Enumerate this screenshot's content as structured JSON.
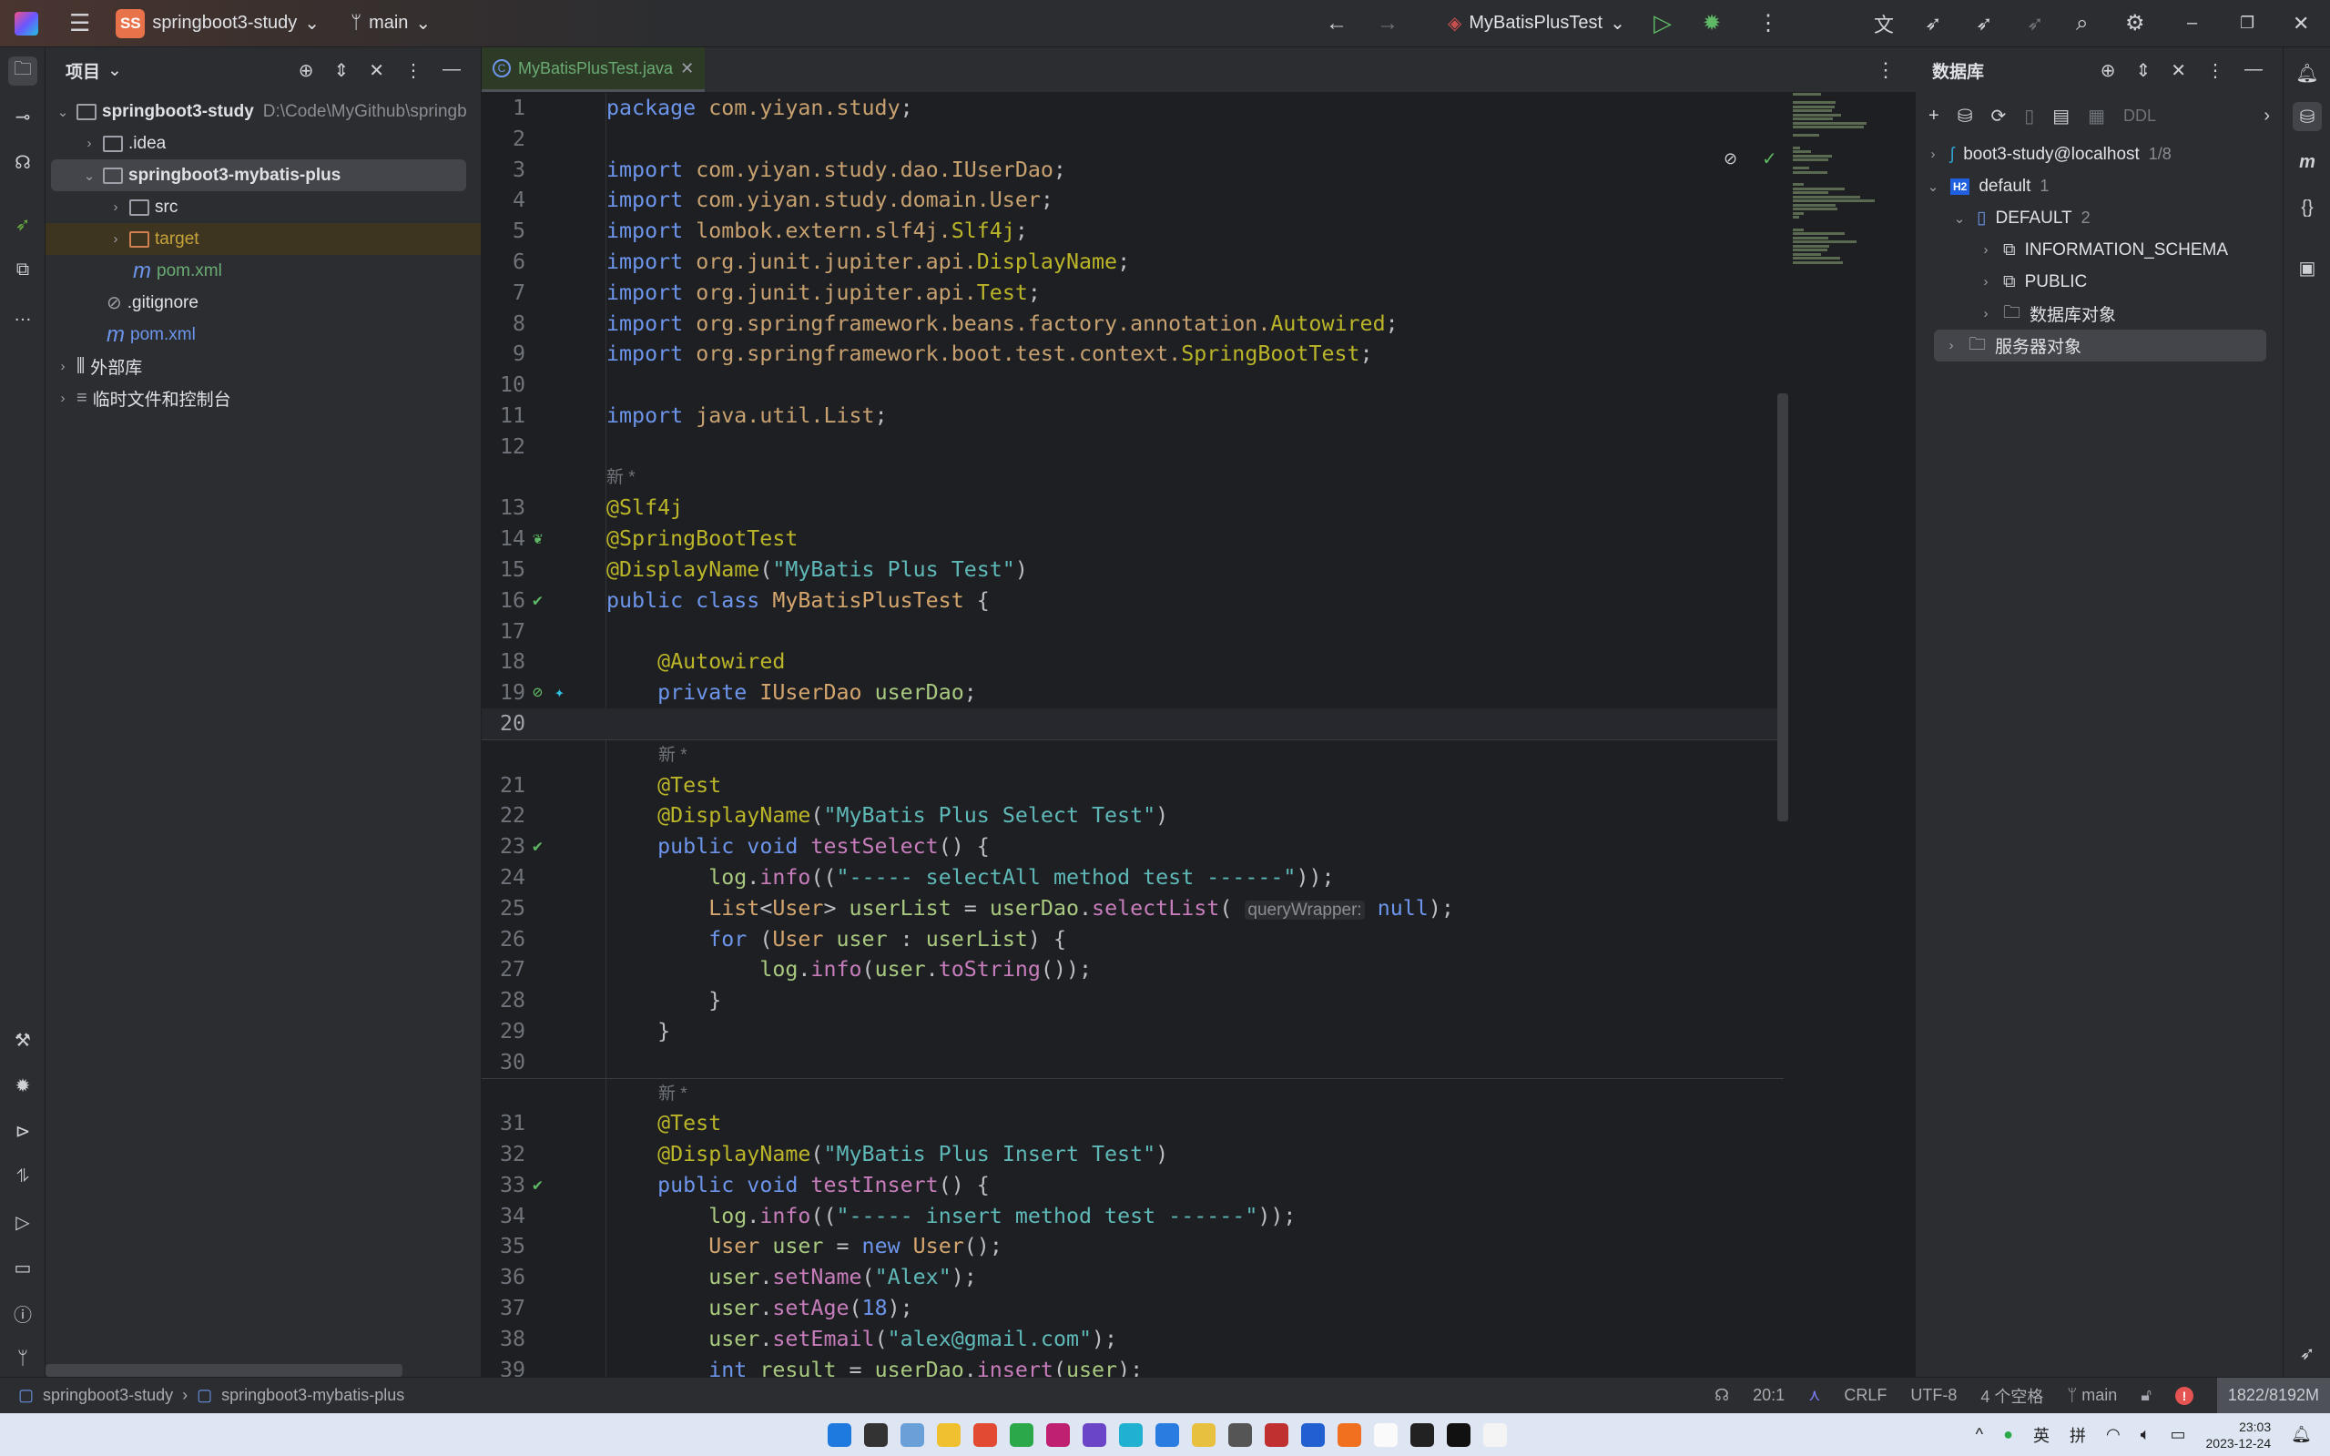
{
  "titlebar": {
    "project_badge": "SS",
    "project": "springboot3-study",
    "branch": "main",
    "run_config": "MyBatisPlusTest"
  },
  "project_panel": {
    "title": "项目",
    "items": [
      {
        "label": "springboot3-study",
        "path": "D:\\Code\\MyGithub\\springb",
        "level": 0,
        "open": true,
        "bold": true,
        "type": "module"
      },
      {
        "label": ".idea",
        "level": 1,
        "open": false,
        "type": "folder"
      },
      {
        "label": "springboot3-mybatis-plus",
        "level": 1,
        "open": true,
        "bold": true,
        "type": "module",
        "selected": true
      },
      {
        "label": "src",
        "level": 2,
        "open": false,
        "type": "folder"
      },
      {
        "label": "target",
        "level": 2,
        "open": false,
        "type": "excluded-folder"
      },
      {
        "label": "pom.xml",
        "level": 2,
        "type": "maven",
        "color": "#6aab73"
      },
      {
        "label": ".gitignore",
        "level": 1,
        "type": "ignore"
      },
      {
        "label": "pom.xml",
        "level": 1,
        "type": "maven",
        "color": "#6c95eb"
      },
      {
        "label": "外部库",
        "level": 0,
        "open": false,
        "type": "library"
      },
      {
        "label": "临时文件和控制台",
        "level": 0,
        "open": false,
        "type": "scratch"
      }
    ]
  },
  "editor": {
    "tab": "MyBatisPlusTest.java",
    "inlay_new": "新 *",
    "lines": [
      {
        "n": "1",
        "t": [
          [
            "kw",
            "package "
          ],
          [
            "pk",
            "com.yiyan.study"
          ],
          [
            "pl",
            ";"
          ]
        ]
      },
      {
        "n": "2",
        "t": []
      },
      {
        "n": "3",
        "t": [
          [
            "kw",
            "import "
          ],
          [
            "pk",
            "com.yiyan.study.dao.IUserDao"
          ],
          [
            "pl",
            ";"
          ]
        ]
      },
      {
        "n": "4",
        "t": [
          [
            "kw",
            "import "
          ],
          [
            "pk",
            "com.yiyan.study.domain.User"
          ],
          [
            "pl",
            ";"
          ]
        ]
      },
      {
        "n": "5",
        "t": [
          [
            "kw",
            "import "
          ],
          [
            "pk",
            "lombok.extern.slf4j."
          ],
          [
            "an",
            "Slf4j"
          ],
          [
            "pl",
            ";"
          ]
        ]
      },
      {
        "n": "6",
        "t": [
          [
            "kw",
            "import "
          ],
          [
            "pk",
            "org.junit.jupiter.api."
          ],
          [
            "an",
            "DisplayName"
          ],
          [
            "pl",
            ";"
          ]
        ]
      },
      {
        "n": "7",
        "t": [
          [
            "kw",
            "import "
          ],
          [
            "pk",
            "org.junit.jupiter.api."
          ],
          [
            "an",
            "Test"
          ],
          [
            "pl",
            ";"
          ]
        ]
      },
      {
        "n": "8",
        "t": [
          [
            "kw",
            "import "
          ],
          [
            "pk",
            "org.springframework.beans.factory.annotation."
          ],
          [
            "an",
            "Autowired"
          ],
          [
            "pl",
            ";"
          ]
        ]
      },
      {
        "n": "9",
        "t": [
          [
            "kw",
            "import "
          ],
          [
            "pk",
            "org.springframework.boot.test.context."
          ],
          [
            "an",
            "SpringBootTest"
          ],
          [
            "pl",
            ";"
          ]
        ]
      },
      {
        "n": "10",
        "t": []
      },
      {
        "n": "11",
        "t": [
          [
            "kw",
            "import "
          ],
          [
            "pk",
            "java.util.List"
          ],
          [
            "pl",
            ";"
          ]
        ]
      },
      {
        "n": "12",
        "t": []
      },
      {
        "inlay": true,
        "indent": 0
      },
      {
        "n": "13",
        "t": [
          [
            "an",
            "@Slf4j"
          ]
        ]
      },
      {
        "n": "14",
        "g": "spring-bean-icon",
        "t": [
          [
            "an",
            "@SpringBootTest"
          ]
        ]
      },
      {
        "n": "15",
        "t": [
          [
            "an",
            "@DisplayName"
          ],
          [
            "pl",
            "("
          ],
          [
            "st",
            "\"MyBatis Plus Test\""
          ],
          [
            "pl",
            ")"
          ]
        ]
      },
      {
        "n": "16",
        "g": "run-test-icon",
        "t": [
          [
            "kw",
            "public class "
          ],
          [
            "ty",
            "MyBatisPlusTest"
          ],
          [
            "pl",
            " {"
          ]
        ]
      },
      {
        "n": "17",
        "t": []
      },
      {
        "n": "18",
        "t": [
          [
            "pl",
            "    "
          ],
          [
            "an",
            "@Autowired"
          ]
        ]
      },
      {
        "n": "19",
        "g": "autowired-bean-icon",
        "g2": "mybatis-bird-icon",
        "t": [
          [
            "pl",
            "    "
          ],
          [
            "kw",
            "private "
          ],
          [
            "ty",
            "IUserDao "
          ],
          [
            "vr",
            "userDao"
          ],
          [
            "pl",
            ";"
          ]
        ]
      },
      {
        "n": "20",
        "cur": true,
        "t": []
      },
      {
        "inlay": true,
        "indent": 1,
        "sep": true
      },
      {
        "n": "21",
        "t": [
          [
            "pl",
            "    "
          ],
          [
            "an",
            "@Test"
          ]
        ]
      },
      {
        "n": "22",
        "t": [
          [
            "pl",
            "    "
          ],
          [
            "an",
            "@DisplayName"
          ],
          [
            "pl",
            "("
          ],
          [
            "st",
            "\"MyBatis Plus Select Test\""
          ],
          [
            "pl",
            ")"
          ]
        ]
      },
      {
        "n": "23",
        "g": "run-test-icon",
        "t": [
          [
            "pl",
            "    "
          ],
          [
            "kw",
            "public void "
          ],
          [
            "me",
            "testSelect"
          ],
          [
            "pl",
            "() {"
          ]
        ]
      },
      {
        "n": "24",
        "t": [
          [
            "pl",
            "        "
          ],
          [
            "vr",
            "log"
          ],
          [
            "pl",
            "."
          ],
          [
            "me",
            "info"
          ],
          [
            "pl",
            "(("
          ],
          [
            "st",
            "\"----- selectAll method test ------\""
          ],
          [
            "pl",
            "));"
          ]
        ]
      },
      {
        "n": "25",
        "t": [
          [
            "pl",
            "        "
          ],
          [
            "ty",
            "List"
          ],
          [
            "pl",
            "<"
          ],
          [
            "ty",
            "User"
          ],
          [
            "pl",
            "> "
          ],
          [
            "vr",
            "userList"
          ],
          [
            "pl",
            " = "
          ],
          [
            "vr",
            "userDao"
          ],
          [
            "pl",
            "."
          ],
          [
            "me",
            "selectList"
          ],
          [
            "pl",
            "( "
          ],
          [
            "hint",
            "queryWrapper:"
          ],
          [
            "kw",
            " null"
          ],
          [
            "pl",
            ");"
          ]
        ]
      },
      {
        "n": "26",
        "t": [
          [
            "pl",
            "        "
          ],
          [
            "kw",
            "for "
          ],
          [
            "pl",
            "("
          ],
          [
            "ty",
            "User "
          ],
          [
            "vr",
            "user"
          ],
          [
            "pl",
            " : "
          ],
          [
            "vr",
            "userList"
          ],
          [
            "pl",
            ") {"
          ]
        ]
      },
      {
        "n": "27",
        "t": [
          [
            "pl",
            "            "
          ],
          [
            "vr",
            "log"
          ],
          [
            "pl",
            "."
          ],
          [
            "me",
            "info"
          ],
          [
            "pl",
            "("
          ],
          [
            "vr",
            "user"
          ],
          [
            "pl",
            "."
          ],
          [
            "me",
            "toString"
          ],
          [
            "pl",
            "());"
          ]
        ]
      },
      {
        "n": "28",
        "t": [
          [
            "pl",
            "        }"
          ]
        ]
      },
      {
        "n": "29",
        "t": [
          [
            "pl",
            "    }"
          ]
        ]
      },
      {
        "n": "30",
        "t": []
      },
      {
        "inlay": true,
        "indent": 1,
        "sep": true
      },
      {
        "n": "31",
        "t": [
          [
            "pl",
            "    "
          ],
          [
            "an",
            "@Test"
          ]
        ]
      },
      {
        "n": "32",
        "t": [
          [
            "pl",
            "    "
          ],
          [
            "an",
            "@DisplayName"
          ],
          [
            "pl",
            "("
          ],
          [
            "st",
            "\"MyBatis Plus Insert Test\""
          ],
          [
            "pl",
            ")"
          ]
        ]
      },
      {
        "n": "33",
        "g": "run-test-icon",
        "t": [
          [
            "pl",
            "    "
          ],
          [
            "kw",
            "public void "
          ],
          [
            "me",
            "testInsert"
          ],
          [
            "pl",
            "() {"
          ]
        ]
      },
      {
        "n": "34",
        "t": [
          [
            "pl",
            "        "
          ],
          [
            "vr",
            "log"
          ],
          [
            "pl",
            "."
          ],
          [
            "me",
            "info"
          ],
          [
            "pl",
            "(("
          ],
          [
            "st",
            "\"----- insert method test ------\""
          ],
          [
            "pl",
            "));"
          ]
        ]
      },
      {
        "n": "35",
        "t": [
          [
            "pl",
            "        "
          ],
          [
            "ty",
            "User "
          ],
          [
            "vr",
            "user"
          ],
          [
            "pl",
            " = "
          ],
          [
            "kw",
            "new "
          ],
          [
            "ty",
            "User"
          ],
          [
            "pl",
            "();"
          ]
        ]
      },
      {
        "n": "36",
        "t": [
          [
            "pl",
            "        "
          ],
          [
            "vr",
            "user"
          ],
          [
            "pl",
            "."
          ],
          [
            "me",
            "setName"
          ],
          [
            "pl",
            "("
          ],
          [
            "st",
            "\"Alex\""
          ],
          [
            "pl",
            ");"
          ]
        ]
      },
      {
        "n": "37",
        "t": [
          [
            "pl",
            "        "
          ],
          [
            "vr",
            "user"
          ],
          [
            "pl",
            "."
          ],
          [
            "me",
            "setAge"
          ],
          [
            "pl",
            "("
          ],
          [
            "kw",
            "18"
          ],
          [
            "pl",
            ");"
          ]
        ]
      },
      {
        "n": "38",
        "t": [
          [
            "pl",
            "        "
          ],
          [
            "vr",
            "user"
          ],
          [
            "pl",
            "."
          ],
          [
            "me",
            "setEmail"
          ],
          [
            "pl",
            "("
          ],
          [
            "st",
            "\"alex@gmail.com\""
          ],
          [
            "pl",
            ");"
          ]
        ]
      },
      {
        "n": "39",
        "t": [
          [
            "pl",
            "        "
          ],
          [
            "kw",
            "int "
          ],
          [
            "vr",
            "result"
          ],
          [
            "pl",
            " = "
          ],
          [
            "vr",
            "userDao"
          ],
          [
            "pl",
            "."
          ],
          [
            "me",
            "insert"
          ],
          [
            "pl",
            "("
          ],
          [
            "vr",
            "user"
          ],
          [
            "pl",
            ");"
          ]
        ]
      }
    ]
  },
  "database_panel": {
    "title": "数据库",
    "ddl_label": "DDL",
    "items": [
      {
        "label": "boot3-study@localhost",
        "badge": "1/8",
        "level": 0,
        "open": false,
        "type": "mysql"
      },
      {
        "label": "default",
        "badge": "1",
        "level": 0,
        "open": true,
        "type": "h2"
      },
      {
        "label": "DEFAULT",
        "badge": "2",
        "level": 1,
        "open": true,
        "type": "database"
      },
      {
        "label": "INFORMATION_SCHEMA",
        "level": 2,
        "open": false,
        "type": "schema"
      },
      {
        "label": "PUBLIC",
        "level": 2,
        "open": false,
        "type": "schema"
      },
      {
        "label": "数据库对象",
        "level": 2,
        "open": false,
        "type": "db-objects"
      },
      {
        "label": "服务器对象",
        "level": 1,
        "open": false,
        "type": "server-objects",
        "selected": true
      }
    ]
  },
  "statusbar": {
    "breadcrumb": [
      "springboot3-study",
      "springboot3-mybatis-plus"
    ],
    "position": "20:1",
    "line_ending": "CRLF",
    "encoding": "UTF-8",
    "indent": "4 个空格",
    "branch": "main",
    "memory": "1822/8192M"
  },
  "taskbar": {
    "apps": [
      {
        "name": "start",
        "color": "#1f7ae0"
      },
      {
        "name": "terminal",
        "color": "#333"
      },
      {
        "name": "photos",
        "color": "#6aa0d8"
      },
      {
        "name": "file-explorer",
        "color": "#f0c030"
      },
      {
        "name": "chrome",
        "color": "#e34a33"
      },
      {
        "name": "wechat",
        "color": "#2aa84a"
      },
      {
        "name": "intellij-idea",
        "color": "#c02070"
      },
      {
        "name": "app-purple",
        "color": "#6b45c8"
      },
      {
        "name": "app-cyan",
        "color": "#20b0d0"
      },
      {
        "name": "vscode",
        "color": "#2a7de0"
      },
      {
        "name": "app-yellow",
        "color": "#e8c040"
      },
      {
        "name": "app-panda",
        "color": "#555"
      },
      {
        "name": "app-red",
        "color": "#c03030"
      },
      {
        "name": "app-blue",
        "color": "#2060d0"
      },
      {
        "name": "app-orange",
        "color": "#f07020"
      },
      {
        "name": "typora",
        "color": "#fafafa"
      },
      {
        "name": "app-cat",
        "color": "#222"
      },
      {
        "name": "github",
        "color": "#111"
      },
      {
        "name": "remote-desktop",
        "color": "#f4f4f4"
      }
    ],
    "ime_lang": "英",
    "ime_mode": "拼",
    "time": "23:03",
    "date": "2023-12-24"
  }
}
